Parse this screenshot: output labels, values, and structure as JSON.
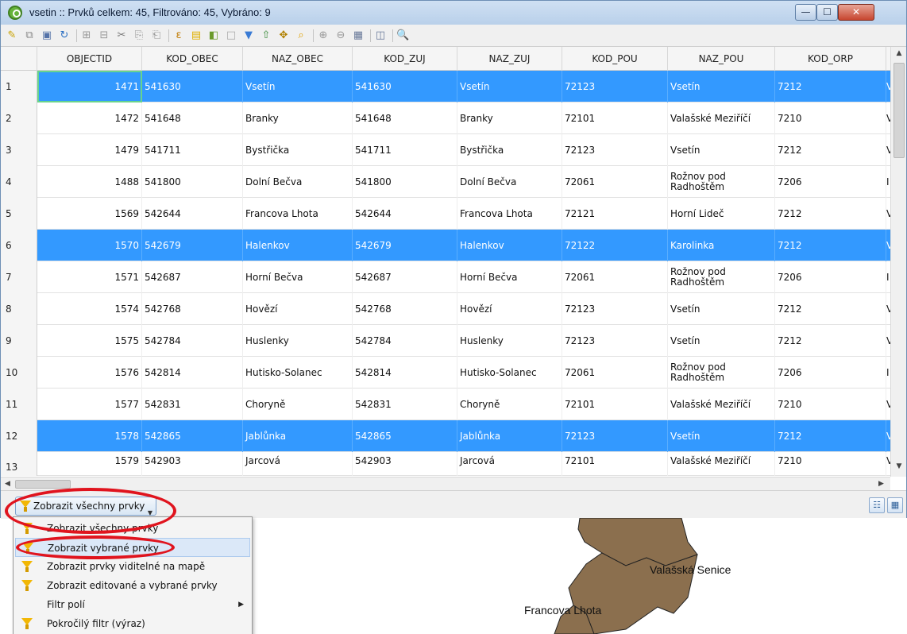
{
  "window": {
    "title": "vsetin :: Prvků celkem: 45, Filtrováno: 45, Vybráno: 9",
    "min_label": "—",
    "max_label": "☐",
    "close_label": "✕"
  },
  "toolbar": {
    "icons": [
      "edit-pencil-icon",
      "multi-edit-icon",
      "save-icon",
      "reload-icon",
      "add-feature-icon",
      "delete-feature-icon",
      "cut-icon",
      "copy-icon",
      "paste-icon",
      "expression-select-icon",
      "select-all-icon",
      "invert-selection-icon",
      "deselect-icon",
      "filter-selection-icon",
      "move-selection-top-icon",
      "pan-to-selection-icon",
      "zoom-to-selection-icon",
      "new-field-icon",
      "delete-field-icon",
      "field-calculator-icon",
      "conditional-format-icon",
      "zoom-map-icon"
    ]
  },
  "table": {
    "columns": [
      "OBJECTID",
      "KOD_OBEC",
      "NAZ_OBEC",
      "KOD_ZUJ",
      "NAZ_ZUJ",
      "KOD_POU",
      "NAZ_POU",
      "KOD_ORP"
    ],
    "rows": [
      {
        "n": "1",
        "selected": true,
        "cells": [
          "1471",
          "541630",
          "Vsetín",
          "541630",
          "Vsetín",
          "72123",
          "Vsetín",
          "7212"
        ],
        "edge": "V"
      },
      {
        "n": "2",
        "selected": false,
        "cells": [
          "1472",
          "541648",
          "Branky",
          "541648",
          "Branky",
          "72101",
          "Valašské Meziříčí",
          "7210"
        ],
        "edge": "V"
      },
      {
        "n": "3",
        "selected": false,
        "cells": [
          "1479",
          "541711",
          "Bystřička",
          "541711",
          "Bystřička",
          "72123",
          "Vsetín",
          "7212"
        ],
        "edge": "V"
      },
      {
        "n": "4",
        "selected": false,
        "cells": [
          "1488",
          "541800",
          "Dolní Bečva",
          "541800",
          "Dolní Bečva",
          "72061",
          "Rožnov pod Radhoštěm",
          "7206"
        ],
        "edge": "I"
      },
      {
        "n": "5",
        "selected": false,
        "cells": [
          "1569",
          "542644",
          "Francova Lhota",
          "542644",
          "Francova Lhota",
          "72121",
          "Horní Lideč",
          "7212"
        ],
        "edge": "V"
      },
      {
        "n": "6",
        "selected": true,
        "cells": [
          "1570",
          "542679",
          "Halenkov",
          "542679",
          "Halenkov",
          "72122",
          "Karolinka",
          "7212"
        ],
        "edge": "V"
      },
      {
        "n": "7",
        "selected": false,
        "cells": [
          "1571",
          "542687",
          "Horní Bečva",
          "542687",
          "Horní Bečva",
          "72061",
          "Rožnov pod Radhoštěm",
          "7206"
        ],
        "edge": "I"
      },
      {
        "n": "8",
        "selected": false,
        "cells": [
          "1574",
          "542768",
          "Hovězí",
          "542768",
          "Hovězí",
          "72123",
          "Vsetín",
          "7212"
        ],
        "edge": "V"
      },
      {
        "n": "9",
        "selected": false,
        "cells": [
          "1575",
          "542784",
          "Huslenky",
          "542784",
          "Huslenky",
          "72123",
          "Vsetín",
          "7212"
        ],
        "edge": "V"
      },
      {
        "n": "10",
        "selected": false,
        "cells": [
          "1576",
          "542814",
          "Hutisko-Solanec",
          "542814",
          "Hutisko-Solanec",
          "72061",
          "Rožnov pod Radhoštěm",
          "7206"
        ],
        "edge": "I"
      },
      {
        "n": "11",
        "selected": false,
        "cells": [
          "1577",
          "542831",
          "Choryně",
          "542831",
          "Choryně",
          "72101",
          "Valašské Meziříčí",
          "7210"
        ],
        "edge": "V"
      },
      {
        "n": "12",
        "selected": true,
        "cells": [
          "1578",
          "542865",
          "Jablůnka",
          "542865",
          "Jablůnka",
          "72123",
          "Vsetín",
          "7212"
        ],
        "edge": "V"
      },
      {
        "n": "13",
        "selected": false,
        "cells": [
          "1579",
          "542903",
          "Jarcová",
          "542903",
          "Jarcová",
          "72101",
          "Valašské Meziříčí",
          "7210"
        ],
        "edge": "V"
      }
    ]
  },
  "filterbar": {
    "button_label": "Zobrazit všechny prvky"
  },
  "menu": {
    "items": [
      {
        "label": "Zobrazit všechny prvky",
        "icon": "funnel-icon",
        "hover": false,
        "submenu": false
      },
      {
        "label": "Zobrazit vybrané prvky",
        "icon": "funnel-icon",
        "hover": true,
        "submenu": false
      },
      {
        "label": "Zobrazit prvky viditelné na mapě",
        "icon": "funnel-icon",
        "hover": false,
        "submenu": false
      },
      {
        "label": "Zobrazit editované a vybrané prvky",
        "icon": "funnel-icon",
        "hover": false,
        "submenu": false
      },
      {
        "label": "Filtr polí",
        "icon": "",
        "hover": false,
        "submenu": true
      },
      {
        "label": "Pokročilý filtr (výraz)",
        "icon": "funnel-icon",
        "hover": false,
        "submenu": false
      }
    ]
  },
  "map": {
    "labels": [
      "Valašská Senice",
      "Francova Lhota"
    ],
    "fill_color": "#8b6f4e"
  },
  "colors": {
    "selection": "#3399ff",
    "annotation": "#e0141e"
  }
}
